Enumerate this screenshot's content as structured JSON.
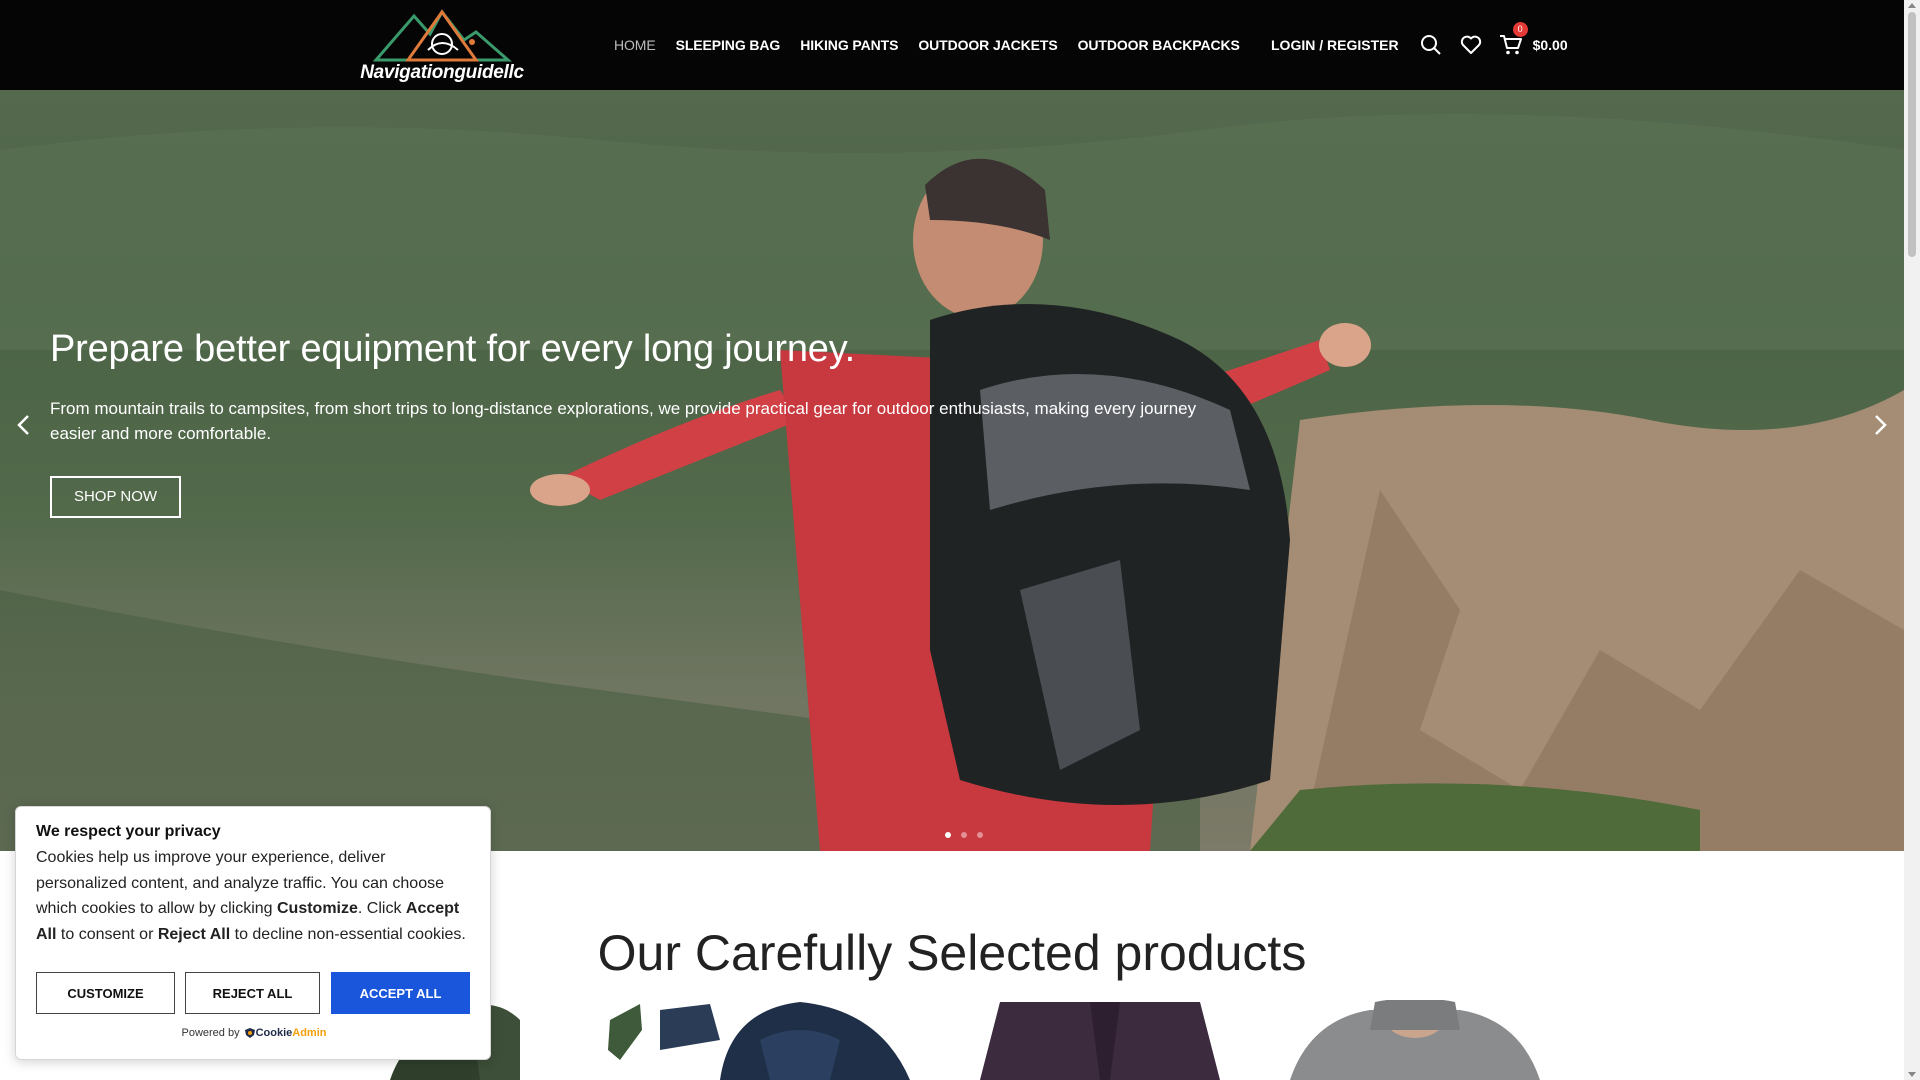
{
  "header": {
    "logo_text": "Navigationguidellc",
    "nav": [
      {
        "label": "HOME",
        "active": true
      },
      {
        "label": "SLEEPING BAG",
        "active": false
      },
      {
        "label": "HIKING PANTS",
        "active": false
      },
      {
        "label": "OUTDOOR JACKETS",
        "active": false
      },
      {
        "label": "OUTDOOR BACKPACKS",
        "active": false
      }
    ],
    "login_label": "LOGIN / REGISTER",
    "icons": [
      "search-icon",
      "heart-icon",
      "cart-icon"
    ],
    "cart_count": "0",
    "cart_total": "$0.00"
  },
  "hero": {
    "title": "Prepare better equipment for every long journey.",
    "subtitle": "From mountain trails to campsites, from short trips to long-distance explorations, we provide practical gear for outdoor enthusiasts, making every journey easier and more comfortable.",
    "button_label": "SHOP NOW",
    "slide_count": 3,
    "active_slide": 1
  },
  "products_section": {
    "title": "Our Carefully Selected products",
    "items": [
      "dark-green-jacket",
      "navy-hooded-jacket",
      "purple-jacket",
      "grey-hooded-jacket"
    ]
  },
  "cookie": {
    "title": "We respect your privacy",
    "text_1": "Cookies help us improve your experience, deliver personalized content, and analyze traffic. You can choose which cookies to allow by clicking ",
    "customize_word": "Customize",
    "text_2": ". Click ",
    "accept_word": "Accept All",
    "text_3": " to consent or ",
    "reject_word": "Reject All",
    "text_4": " to decline non-essential cookies.",
    "customize_label": "CUSTOMIZE",
    "reject_label": "REJECT ALL",
    "accept_label": "ACCEPT ALL",
    "powered_by": "Powered by",
    "brand_1": "Cookie",
    "brand_2": "Admin"
  },
  "colors": {
    "header_bg": "#050505",
    "accept_button": "#1a56db",
    "cart_badge": "#e53935"
  }
}
